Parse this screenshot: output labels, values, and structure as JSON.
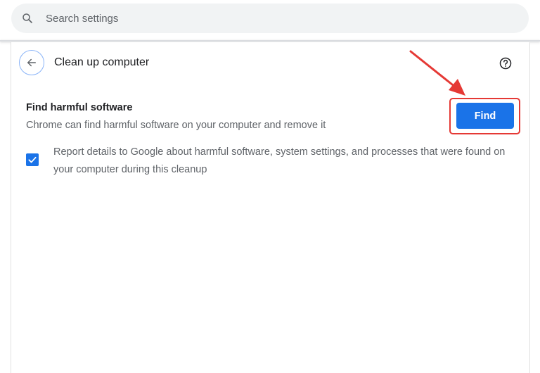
{
  "search": {
    "placeholder": "Search settings"
  },
  "header": {
    "title": "Clean up computer"
  },
  "section": {
    "heading": "Find harmful software",
    "description": "Chrome can find harmful software on your computer and remove it",
    "find_button_label": "Find"
  },
  "report": {
    "checked": true,
    "label": "Report details to Google about harmful software, system settings, and processes that were found on your computer during this cleanup"
  },
  "icons": {
    "search": "search-icon",
    "back": "arrow-back-icon",
    "help": "help-circle-icon",
    "check": "checkmark-icon"
  },
  "colors": {
    "accent": "#1a73e8",
    "annotation": "#e53935",
    "search_bg": "#f1f3f4"
  }
}
